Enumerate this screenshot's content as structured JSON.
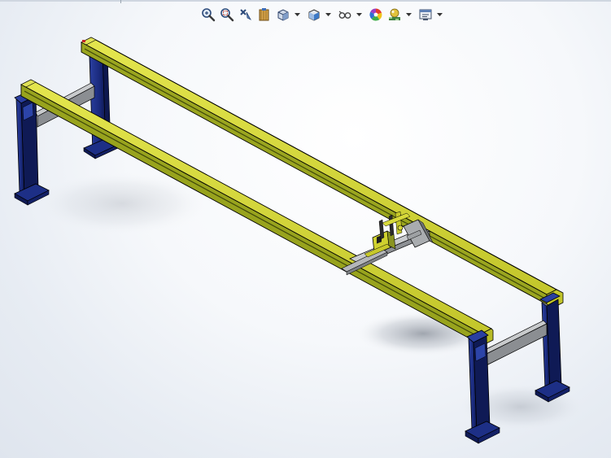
{
  "viewport": {
    "background_top": "#ffffff",
    "background_edge": "#dfe5ee"
  },
  "heads_up_toolbar": {
    "items": [
      {
        "icon": "zoom-to-fit-icon",
        "has_dropdown": false
      },
      {
        "icon": "zoom-to-area-icon",
        "has_dropdown": false
      },
      {
        "icon": "previous-view-icon",
        "has_dropdown": false
      },
      {
        "icon": "section-view-icon",
        "has_dropdown": false
      },
      {
        "icon": "view-orientation-icon",
        "has_dropdown": true
      },
      {
        "icon": "display-style-icon",
        "has_dropdown": true
      },
      {
        "icon": "hide-show-items-icon",
        "has_dropdown": true
      },
      {
        "icon": "edit-appearance-icon",
        "has_dropdown": false
      },
      {
        "icon": "apply-scene-icon",
        "has_dropdown": true
      },
      {
        "icon": "view-settings-icon",
        "has_dropdown": true
      }
    ]
  },
  "model": {
    "name": "gantry-assembly",
    "colors": {
      "rail_top": "#d4d63a",
      "rail_side": "#8e9a1a",
      "rail_shadow": "#5e6a10",
      "leg_front": "#1d2f86",
      "leg_side": "#0f1a55",
      "crossbar": "#b7b9bc",
      "crossbar_dark": "#7d8084",
      "carriage_yellow": "#c7c92a",
      "carriage_grey": "#a9acaf",
      "outline": "#000000"
    }
  }
}
